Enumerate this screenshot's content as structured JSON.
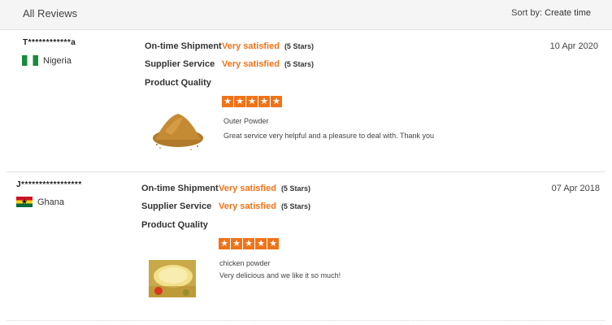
{
  "header": {
    "title": "All Reviews",
    "sort_label": "Sort by:",
    "sort_value": "Create time"
  },
  "colors": {
    "accent": "#f07318"
  },
  "reviews": [
    {
      "user": "T************a",
      "country": "Nigeria",
      "flag_icon": "nigeria-flag-icon",
      "date": "10 Apr 2020",
      "ratings": [
        {
          "label": "On-time Shipment",
          "value": "Very satisfied",
          "stars_text": "(5 Stars)"
        },
        {
          "label": "Supplier Service",
          "value": "Very satisfied",
          "stars_text": "(5 Stars)"
        },
        {
          "label": "Product Quality",
          "value": "",
          "stars_text": ""
        }
      ],
      "quality_stars": 5,
      "product": "Outer Powder",
      "comment": "Great service very helpful and a pleasure to deal with. Thank you"
    },
    {
      "user": "J*****************",
      "country": "Ghana",
      "flag_icon": "ghana-flag-icon",
      "date": "07 Apr 2018",
      "ratings": [
        {
          "label": "On-time Shipment",
          "value": "Very satisfied",
          "stars_text": "(5 Stars)"
        },
        {
          "label": "Supplier Service",
          "value": "Very satisfied",
          "stars_text": "(5 Stars)"
        },
        {
          "label": "Product Quality",
          "value": "",
          "stars_text": ""
        }
      ],
      "quality_stars": 5,
      "product": "chicken powder",
      "comment": "Very delicious and we like it so much!"
    }
  ]
}
